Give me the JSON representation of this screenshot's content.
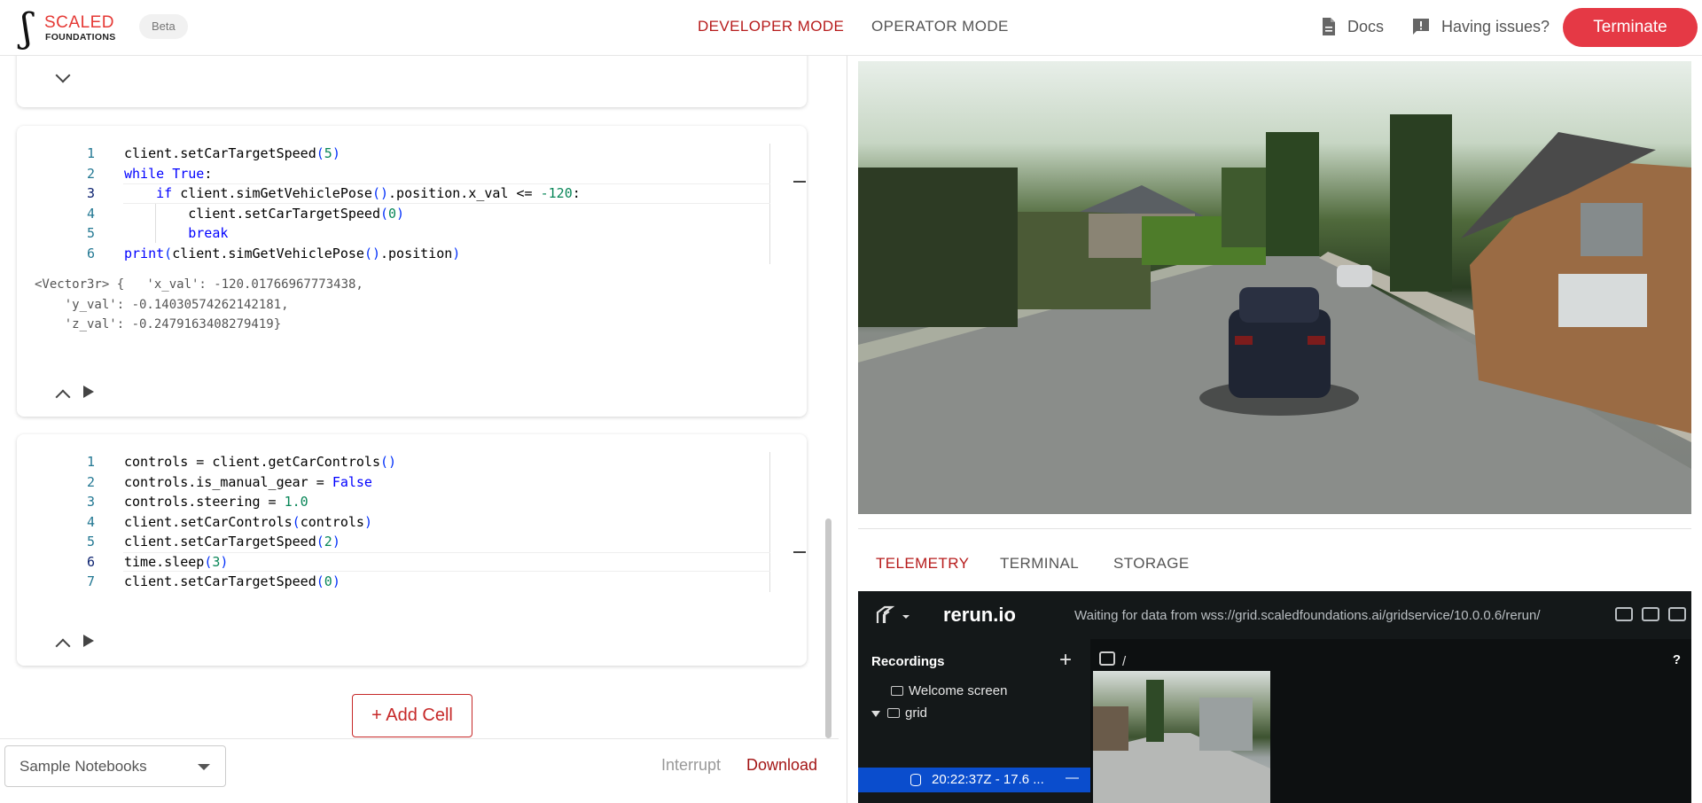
{
  "header": {
    "logo_text": "SCALED",
    "logo_sub": "FOUNDATIONS",
    "beta": "Beta",
    "mode_developer": "DEVELOPER MODE",
    "mode_operator": "OPERATOR MODE",
    "docs": "Docs",
    "issues": "Having issues?",
    "terminate": "Terminate",
    "accent_color": "#e53945"
  },
  "notebook": {
    "cell1": {
      "lines": [
        {
          "n": "1",
          "code": "client.setCarTargetSpeed(5)"
        },
        {
          "n": "2",
          "code": "while True:"
        },
        {
          "n": "3",
          "code": "    if client.simGetVehiclePose().position.x_val <= -120:"
        },
        {
          "n": "4",
          "code": "        client.setCarTargetSpeed(0)"
        },
        {
          "n": "5",
          "code": "        break"
        },
        {
          "n": "6",
          "code": "print(client.simGetVehiclePose().position)"
        }
      ],
      "output": [
        "<Vector3r> {   'x_val': -120.01766967773438,",
        "    'y_val': -0.14030574262142181,",
        "    'z_val': -0.2479163408279419}"
      ]
    },
    "cell2": {
      "lines": [
        {
          "n": "1",
          "code": "controls = client.getCarControls()"
        },
        {
          "n": "2",
          "code": "controls.is_manual_gear = False"
        },
        {
          "n": "3",
          "code": "controls.steering = 1.0"
        },
        {
          "n": "4",
          "code": "client.setCarControls(controls)"
        },
        {
          "n": "5",
          "code": "client.setCarTargetSpeed(2)"
        },
        {
          "n": "6",
          "code": "time.sleep(3)"
        },
        {
          "n": "7",
          "code": "client.setCarTargetSpeed(0)"
        }
      ]
    },
    "add_cell": "+ Add Cell",
    "sample_notebooks": "Sample Notebooks",
    "interrupt": "Interrupt",
    "download": "Download"
  },
  "panel": {
    "tabs": [
      "TELEMETRY",
      "TERMINAL",
      "STORAGE"
    ],
    "active_tab": "TELEMETRY"
  },
  "rerun": {
    "brand": "rerun.io",
    "waiting": "Waiting for data from wss://grid.scaledfoundations.ai/gridservice/10.0.0.6/rerun/",
    "recordings": "Recordings",
    "plus": "+",
    "welcome": "Welcome screen",
    "grid": "grid",
    "recording": "20:22:37Z - 17.6 ...",
    "recording_dash": "—",
    "path": "/",
    "help": "?"
  }
}
